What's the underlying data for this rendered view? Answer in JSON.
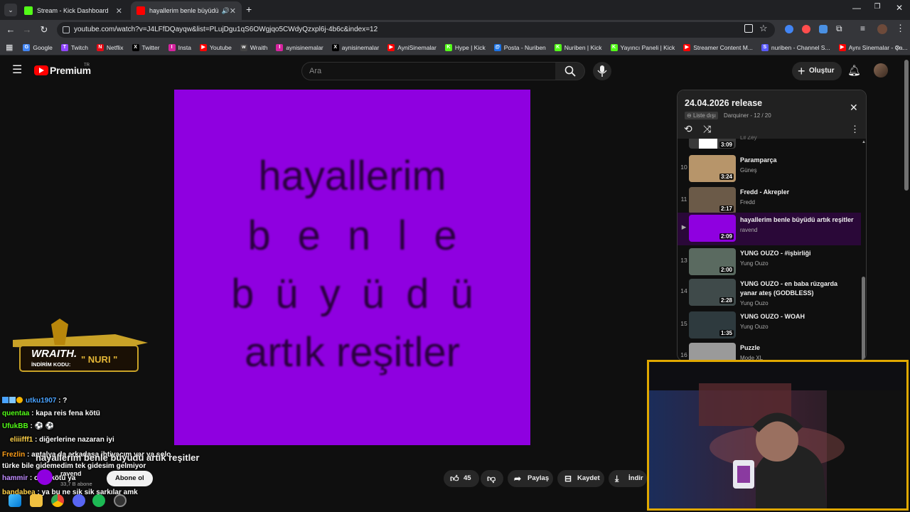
{
  "browser": {
    "tabs": [
      {
        "title": "Stream - Kick Dashboard",
        "active": false
      },
      {
        "title": "hayallerim benle büyüdü artı",
        "active": true
      }
    ],
    "new_tab": "+",
    "url": "youtube.com/watch?v=J4LFfDQayqw&list=PLujDgu1qS6OWgjqo5CWdyQzxpl6j-4b6c&index=12"
  },
  "bookmarks": [
    {
      "label": "Google",
      "color": "#4285f4",
      "glyph": "G"
    },
    {
      "label": "Twitch",
      "color": "#9146ff",
      "glyph": "T"
    },
    {
      "label": "Netflix",
      "color": "#e50914",
      "glyph": "N"
    },
    {
      "label": "Twitter",
      "color": "#000000",
      "glyph": "X"
    },
    {
      "label": "Insta",
      "color": "#d6249f",
      "glyph": "I"
    },
    {
      "label": "Youtube",
      "color": "#ff0000",
      "glyph": "▶"
    },
    {
      "label": "Wraith",
      "color": "#444444",
      "glyph": "w"
    },
    {
      "label": "aynisinemalar",
      "color": "#d6249f",
      "glyph": "I"
    },
    {
      "label": "aynisinemalar",
      "color": "#000000",
      "glyph": "X"
    },
    {
      "label": "AyniSinemalar",
      "color": "#ff0000",
      "glyph": "▶"
    },
    {
      "label": "Hype | Kick",
      "color": "#53fc18",
      "glyph": "K"
    },
    {
      "label": "Posta - Nuriben",
      "color": "#1a73e8",
      "glyph": "@"
    },
    {
      "label": "Nuriben | Kick",
      "color": "#53fc18",
      "glyph": "K"
    },
    {
      "label": "Yayıncı Paneli | Kick",
      "color": "#53fc18",
      "glyph": "K"
    },
    {
      "label": "Streamer Content M...",
      "color": "#ff0000",
      "glyph": "▶"
    },
    {
      "label": "nuriben - Channel S...",
      "color": "#5a5aff",
      "glyph": "S"
    },
    {
      "label": "Aynı Sinemalar - Ça...",
      "color": "#ff0000",
      "glyph": "▶"
    }
  ],
  "youtube": {
    "logo_text": "Premium",
    "logo_region": "TR",
    "search_placeholder": "Ara",
    "create_label": "Oluştur"
  },
  "video": {
    "lines": [
      "hayallerim",
      "b e n l e",
      "b ü y ü d ü",
      "artık reşitler"
    ],
    "title": "hayallerim benle büyüdü artık reşitler",
    "channel": "ravend",
    "subscribers": "33,7 B abone",
    "subscribe_label": "Abone ol",
    "likes": "45",
    "share_label": "Paylaş",
    "save_label": "Kaydet",
    "download_label": "İndir"
  },
  "playlist": {
    "title": "24.04.2026 release",
    "visibility": "Liste dışı",
    "owner_progress": "Darquiner - 12 / 20",
    "partial_top": {
      "channel": "Lil Zey",
      "duration": "3:09"
    },
    "items": [
      {
        "num": "10",
        "title": "Paramparça",
        "channel": "Güneş",
        "duration": "3:24",
        "thumb": "#b7956a"
      },
      {
        "num": "11",
        "title": "Fredd - Akrepler",
        "channel": "Fredd",
        "duration": "2:17",
        "thumb": "#6b5a48"
      },
      {
        "num": "▶",
        "title": "hayallerim benle büyüdü artık reşitler",
        "channel": "ravend",
        "duration": "2:09",
        "thumb": "#8f00e0",
        "current": true
      },
      {
        "num": "13",
        "title": "YUNG OUZO - #işbirliği",
        "channel": "Yung Ouzo",
        "duration": "2:00",
        "thumb": "#5a6a60"
      },
      {
        "num": "14",
        "title": "YUNG OUZO - en baba rüzgarda yanar ateş (GODBLESS)",
        "channel": "Yung Ouzo",
        "duration": "2:28",
        "thumb": "#3f4a4a"
      },
      {
        "num": "15",
        "title": "YUNG OUZO - WOAH",
        "channel": "Yung Ouzo",
        "duration": "1:35",
        "thumb": "#2e3a3e"
      },
      {
        "num": "16",
        "title": "Puzzle",
        "channel": "Mode XL",
        "duration": "",
        "thumb": "#9a9a9a"
      }
    ]
  },
  "promo": {
    "brand": "WRAITH.",
    "code_label": "İNDİRİM KODU:",
    "code": "\" NURI \""
  },
  "chat": [
    {
      "user": "utku1907",
      "color": "#4aa3ff",
      "message": ": ?"
    },
    {
      "user": "quentaa",
      "color": "#53fc18",
      "message": ": kapa reis fena kötü"
    },
    {
      "user": "UfukBB",
      "color": "#53fc18",
      "message": ": ⚽ ⚽"
    },
    {
      "user": "eliiifff1",
      "color": "#ffd24a",
      "message": ": diğerlerine nazaran iyi"
    },
    {
      "user": "Frezlin",
      "color": "#ff9f1a",
      "message": ": antalya da arkadaşa ihtiyacım var ya solo türke bile gidemedim tek gidesim gelmiyor"
    },
    {
      "user": "hammir",
      "color": "#c08cff",
      "message": ": o da kötü ya"
    },
    {
      "user": "bandabea",
      "color": "#ffd24a",
      "message": ": ya bu ne sik sik şarkılar amk"
    }
  ]
}
